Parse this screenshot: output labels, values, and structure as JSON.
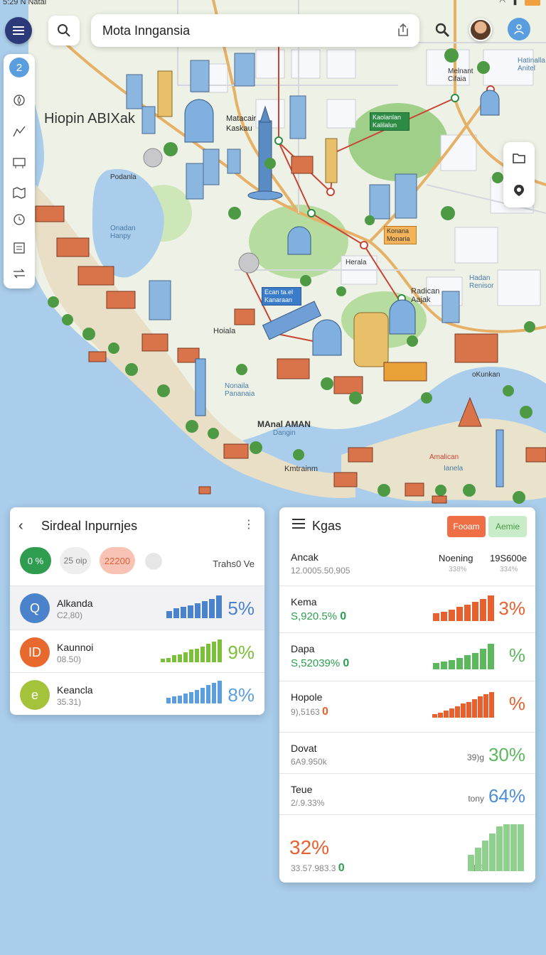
{
  "status_bar": {
    "left": "5:29 N Natal"
  },
  "search": {
    "query": "Mota Inngansia"
  },
  "left_toolbar": {
    "badge": "2"
  },
  "map_labels": {
    "region": "Hiopin ABIXak",
    "district1": "Matacair Kaskau",
    "district2": "Melnant Cifaia",
    "green_tag": "Kaolanlan Kalilalun",
    "orange_tag": "Konana Monaria",
    "blue_tag": "Ecan ta.el Kanaraan",
    "place1": "Podanla",
    "place2": "Onadan Hanpy",
    "place3": "Hoiala",
    "place4": "Nonaila Pananaia",
    "place5": "Herala",
    "place6": "Radican Aajak",
    "place7": "Hadan Renisor",
    "place8": "MAnal AMAN",
    "place9": "Dangin",
    "place10": "Kmtrainm",
    "place11": "oKunkan",
    "place12": "Amalican",
    "place13": "Ianela",
    "place14": "Hatinalla Anitel"
  },
  "left_panel": {
    "title": "Sirdeal Inpurnjes",
    "chips": {
      "green": "0 %",
      "grey": "25 oip",
      "pink": "22200",
      "text": "Trahs0 Ve"
    },
    "rows": [
      {
        "badge": "Q",
        "name": "Alkanda",
        "sub": "C2,80)",
        "pct": "5%",
        "color": "#4a82cc",
        "bars": [
          0.3,
          0.45,
          0.5,
          0.55,
          0.65,
          0.75,
          0.85,
          1.0
        ]
      },
      {
        "badge": "ID",
        "name": "Kaunnoi",
        "sub": "08.50)",
        "pct": "9%",
        "color": "#7bbf3a",
        "bars": [
          0.15,
          0.2,
          0.3,
          0.35,
          0.45,
          0.55,
          0.6,
          0.7,
          0.8,
          0.9,
          1.0
        ]
      },
      {
        "badge": "e",
        "name": "Keancla",
        "sub": "35.31)",
        "pct": "8%",
        "color": "#5b9ee0",
        "bars": [
          0.25,
          0.3,
          0.35,
          0.45,
          0.5,
          0.6,
          0.7,
          0.8,
          0.9,
          1.0
        ]
      }
    ]
  },
  "right_panel": {
    "title": "Kgas",
    "btn_orange": "Fooam",
    "btn_green": "Aemie",
    "summary": {
      "a": "Ancak",
      "b": "12.0005.50,905",
      "c": "Noening",
      "d": "338%",
      "e": "19S600e",
      "f": "334%"
    },
    "rows": [
      {
        "name": "Kema",
        "val": "S,920.5% ",
        "mark": "0",
        "pct": "3%",
        "color": "#e8602e",
        "mark_color": "#2e9d50",
        "kind": "bars",
        "bars": [
          0.3,
          0.35,
          0.45,
          0.55,
          0.65,
          0.75,
          0.85,
          1.0
        ]
      },
      {
        "name": "Dapa",
        "val": "S,52039% ",
        "mark": "0",
        "pct": "%",
        "color": "#5cb85c",
        "mark_color": "#2e9d50",
        "kind": "bars",
        "bars": [
          0.25,
          0.3,
          0.35,
          0.45,
          0.55,
          0.65,
          0.8,
          1.0
        ]
      },
      {
        "name": "Hopole",
        "val": "9),5163 ",
        "mark": "0",
        "pct": "%",
        "color": "#e8602e",
        "mark_color": "#e8602e",
        "kind": "area",
        "bars": [
          0.15,
          0.2,
          0.28,
          0.36,
          0.45,
          0.55,
          0.62,
          0.72,
          0.82,
          0.92,
          1.0
        ]
      },
      {
        "name": "Dovat",
        "val": "6A9.950k",
        "mark": "",
        "pct": "30%",
        "color": "#5cb85c",
        "note": "39)g",
        "kind": "none"
      },
      {
        "name": "Teue",
        "val": "2/.9.33%",
        "mark": "",
        "pct": "64%",
        "color": "#4a8fd4",
        "note": "tony",
        "kind": "none"
      }
    ],
    "footer": {
      "pct": "32%",
      "val": "33.57.983.3 ",
      "mark": "0",
      "note": "31f6",
      "bars": [
        0.35,
        0.5,
        0.65,
        0.8,
        0.95,
        1.0,
        1.0,
        1.0
      ]
    }
  }
}
